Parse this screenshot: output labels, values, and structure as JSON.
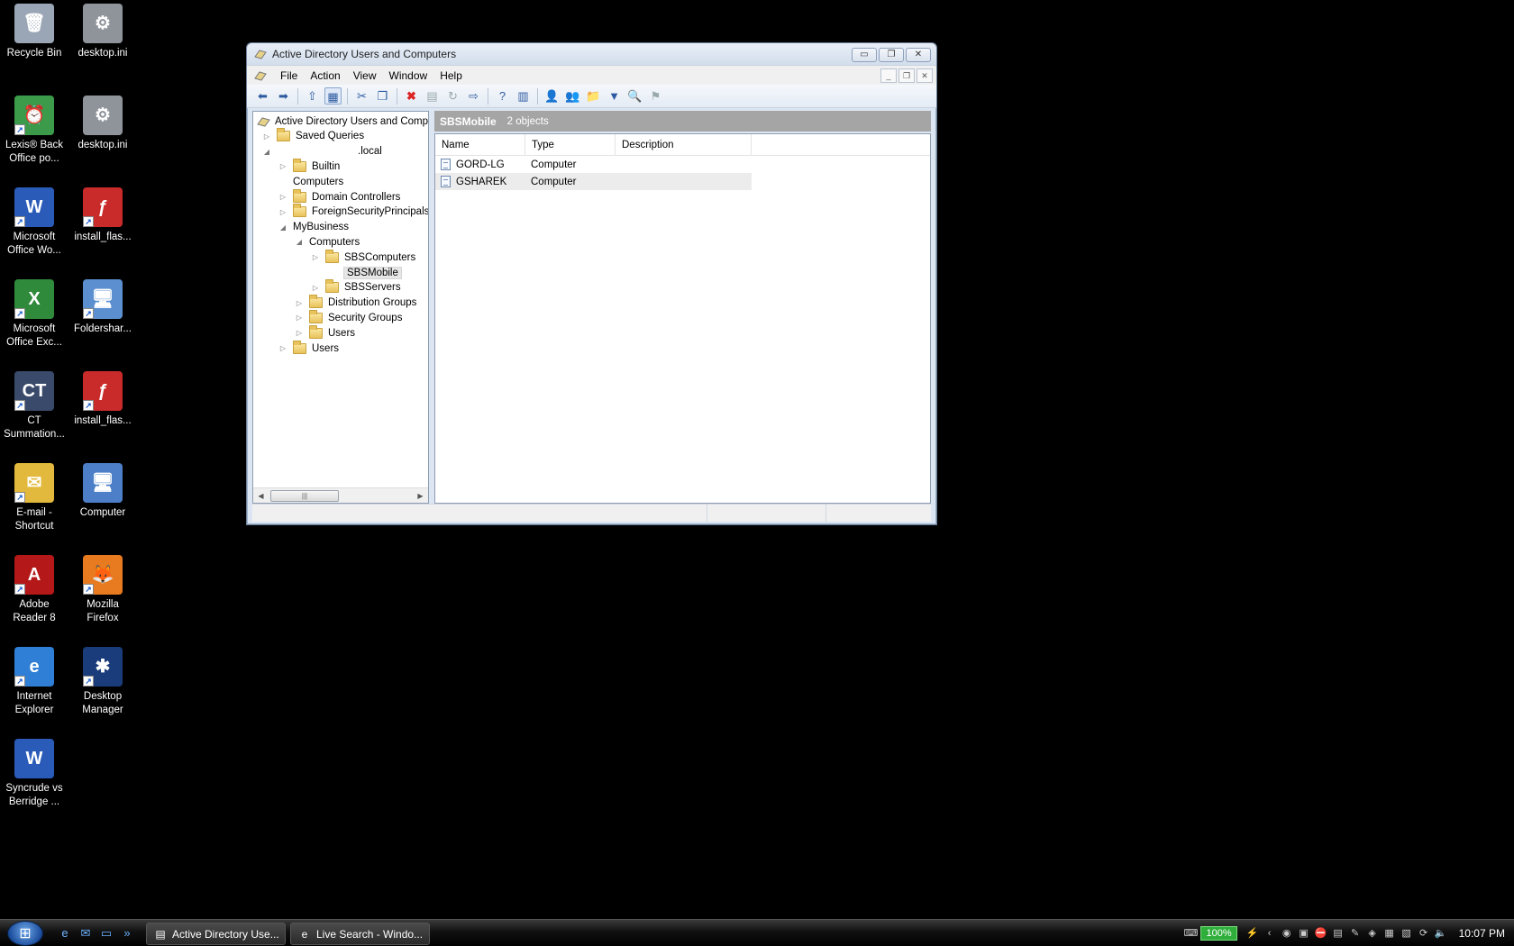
{
  "desktop": {
    "icons": [
      {
        "name": "recycle-bin",
        "label": "Recycle Bin",
        "glyph": "🗑"
      },
      {
        "name": "desktop-ini-1",
        "label": "desktop.ini",
        "glyph": "⚙"
      },
      {
        "name": "lexis-back-office",
        "label": "Lexis® Back\nOffice po...",
        "glyph": "⏰"
      },
      {
        "name": "desktop-ini-2",
        "label": "desktop.ini",
        "glyph": "⚙"
      },
      {
        "name": "microsoft-office-word",
        "label": "Microsoft\nOffice Wo...",
        "glyph": "W"
      },
      {
        "name": "install-flash-1",
        "label": "install_flas...",
        "glyph": "ƒ"
      },
      {
        "name": "microsoft-office-excel",
        "label": "Microsoft\nOffice Exc...",
        "glyph": "X"
      },
      {
        "name": "foldershare",
        "label": "Foldershar...",
        "glyph": "🖥"
      },
      {
        "name": "ct-summation",
        "label": "CT\nSummation...",
        "glyph": "CT"
      },
      {
        "name": "install-flash-2",
        "label": "install_flas...",
        "glyph": "ƒ"
      },
      {
        "name": "email-shortcut",
        "label": "E-mail -\nShortcut",
        "glyph": "✉"
      },
      {
        "name": "computer",
        "label": "Computer",
        "glyph": "🖥"
      },
      {
        "name": "adobe-reader",
        "label": "Adobe\nReader 8",
        "glyph": "A"
      },
      {
        "name": "mozilla-firefox",
        "label": "Mozilla\nFirefox",
        "glyph": "🦊"
      },
      {
        "name": "internet-explorer",
        "label": "Internet\nExplorer",
        "glyph": "e"
      },
      {
        "name": "desktop-manager",
        "label": "Desktop\nManager",
        "glyph": "✱"
      },
      {
        "name": "syncrude-doc",
        "label": "Syncrude vs\nBerridge ...",
        "glyph": "W"
      }
    ]
  },
  "window": {
    "title": "Active Directory Users and Computers",
    "controls": {
      "minimize": "▭",
      "restore": "❐",
      "close": "✕"
    },
    "mdi_controls": {
      "minimize": "_",
      "restore": "❐",
      "close": "✕"
    },
    "menu": [
      "File",
      "Action",
      "View",
      "Window",
      "Help"
    ],
    "toolbar": [
      {
        "name": "back-icon",
        "glyph": "⬅"
      },
      {
        "name": "forward-icon",
        "glyph": "➡"
      },
      {
        "sep": true
      },
      {
        "name": "up-folder-icon",
        "glyph": "⇧"
      },
      {
        "name": "show-hide-tree-icon",
        "glyph": "▦",
        "selected": true
      },
      {
        "sep": true
      },
      {
        "name": "cut-icon",
        "glyph": "✂"
      },
      {
        "name": "copy-icon",
        "glyph": "❐"
      },
      {
        "sep": true
      },
      {
        "name": "delete-icon",
        "glyph": "✖",
        "style": "red"
      },
      {
        "name": "properties-icon",
        "glyph": "▤",
        "style": "dim"
      },
      {
        "name": "refresh-icon",
        "glyph": "↻",
        "style": "dim"
      },
      {
        "name": "export-list-icon",
        "glyph": "⇨"
      },
      {
        "sep": true
      },
      {
        "name": "help-icon",
        "glyph": "?"
      },
      {
        "name": "view-icon",
        "glyph": "▥"
      },
      {
        "sep": true
      },
      {
        "name": "new-user-icon",
        "glyph": "👤"
      },
      {
        "name": "new-group-icon",
        "glyph": "👥"
      },
      {
        "name": "new-ou-icon",
        "glyph": "📁"
      },
      {
        "name": "filter-icon",
        "glyph": "▼"
      },
      {
        "name": "find-icon",
        "glyph": "🔍"
      },
      {
        "name": "add-to-group-icon",
        "glyph": "⚑",
        "style": "dim"
      }
    ],
    "tree": {
      "nodes": [
        {
          "name": "tree-root",
          "label": "Active Directory Users and Compu",
          "level": 0,
          "exp": "",
          "icon": "ad"
        },
        {
          "name": "tree-saved-queries",
          "label": "Saved Queries",
          "level": 1,
          "exp": "▷",
          "icon": "folder"
        },
        {
          "name": "tree-domain",
          "label": ".local",
          "level": 1,
          "exp": "◢",
          "icon": "none",
          "indent_label": true
        },
        {
          "name": "tree-builtin",
          "label": "Builtin",
          "level": 2,
          "exp": "▷",
          "icon": "folder"
        },
        {
          "name": "tree-computers",
          "label": "Computers",
          "level": 2,
          "exp": "",
          "icon": "none",
          "no_icon_offset": true
        },
        {
          "name": "tree-domain-controllers",
          "label": "Domain Controllers",
          "level": 2,
          "exp": "▷",
          "icon": "folder"
        },
        {
          "name": "tree-foreign-security-principals",
          "label": "ForeignSecurityPrincipals",
          "level": 2,
          "exp": "▷",
          "icon": "folder"
        },
        {
          "name": "tree-mybusiness",
          "label": "MyBusiness",
          "level": 2,
          "exp": "◢",
          "icon": "none",
          "no_icon_offset": true
        },
        {
          "name": "tree-mybusiness-computers",
          "label": "Computers",
          "level": 3,
          "exp": "◢",
          "icon": "none",
          "no_icon_offset": true
        },
        {
          "name": "tree-sbscomputers",
          "label": "SBSComputers",
          "level": 4,
          "exp": "▷",
          "icon": "folder"
        },
        {
          "name": "tree-sbsmobile",
          "label": "SBSMobile",
          "level": 4,
          "exp": "",
          "icon": "none",
          "selected": true
        },
        {
          "name": "tree-sbsservers",
          "label": "SBSServers",
          "level": 4,
          "exp": "▷",
          "icon": "folder"
        },
        {
          "name": "tree-distribution-groups",
          "label": "Distribution Groups",
          "level": 3,
          "exp": "▷",
          "icon": "folder"
        },
        {
          "name": "tree-security-groups",
          "label": "Security Groups",
          "level": 3,
          "exp": "▷",
          "icon": "folder"
        },
        {
          "name": "tree-mybusiness-users",
          "label": "Users",
          "level": 3,
          "exp": "▷",
          "icon": "folder"
        },
        {
          "name": "tree-users",
          "label": "Users",
          "level": 2,
          "exp": "▷",
          "icon": "folder"
        }
      ]
    },
    "results": {
      "title": "SBSMobile",
      "count": "2 objects",
      "columns": [
        "Name",
        "Type",
        "Description"
      ],
      "rows": [
        {
          "name": "GORD-LG",
          "type": "Computer"
        },
        {
          "name": "GSHAREK",
          "type": "Computer"
        }
      ]
    }
  },
  "taskbar": {
    "quick_launch": [
      {
        "name": "ie-quicklaunch-icon",
        "glyph": "e"
      },
      {
        "name": "outlook-quicklaunch-icon",
        "glyph": "✉"
      },
      {
        "name": "show-desktop-icon",
        "glyph": "▭"
      },
      {
        "name": "quicklaunch-more-icon",
        "glyph": "»"
      }
    ],
    "buttons": [
      {
        "name": "taskbar-ad-users",
        "label": "Active Directory Use...",
        "glyph": "▤"
      },
      {
        "name": "taskbar-live-search",
        "label": "Live Search - Windo...",
        "glyph": "e"
      }
    ],
    "battery": "100%",
    "clock": "10:07 PM"
  }
}
